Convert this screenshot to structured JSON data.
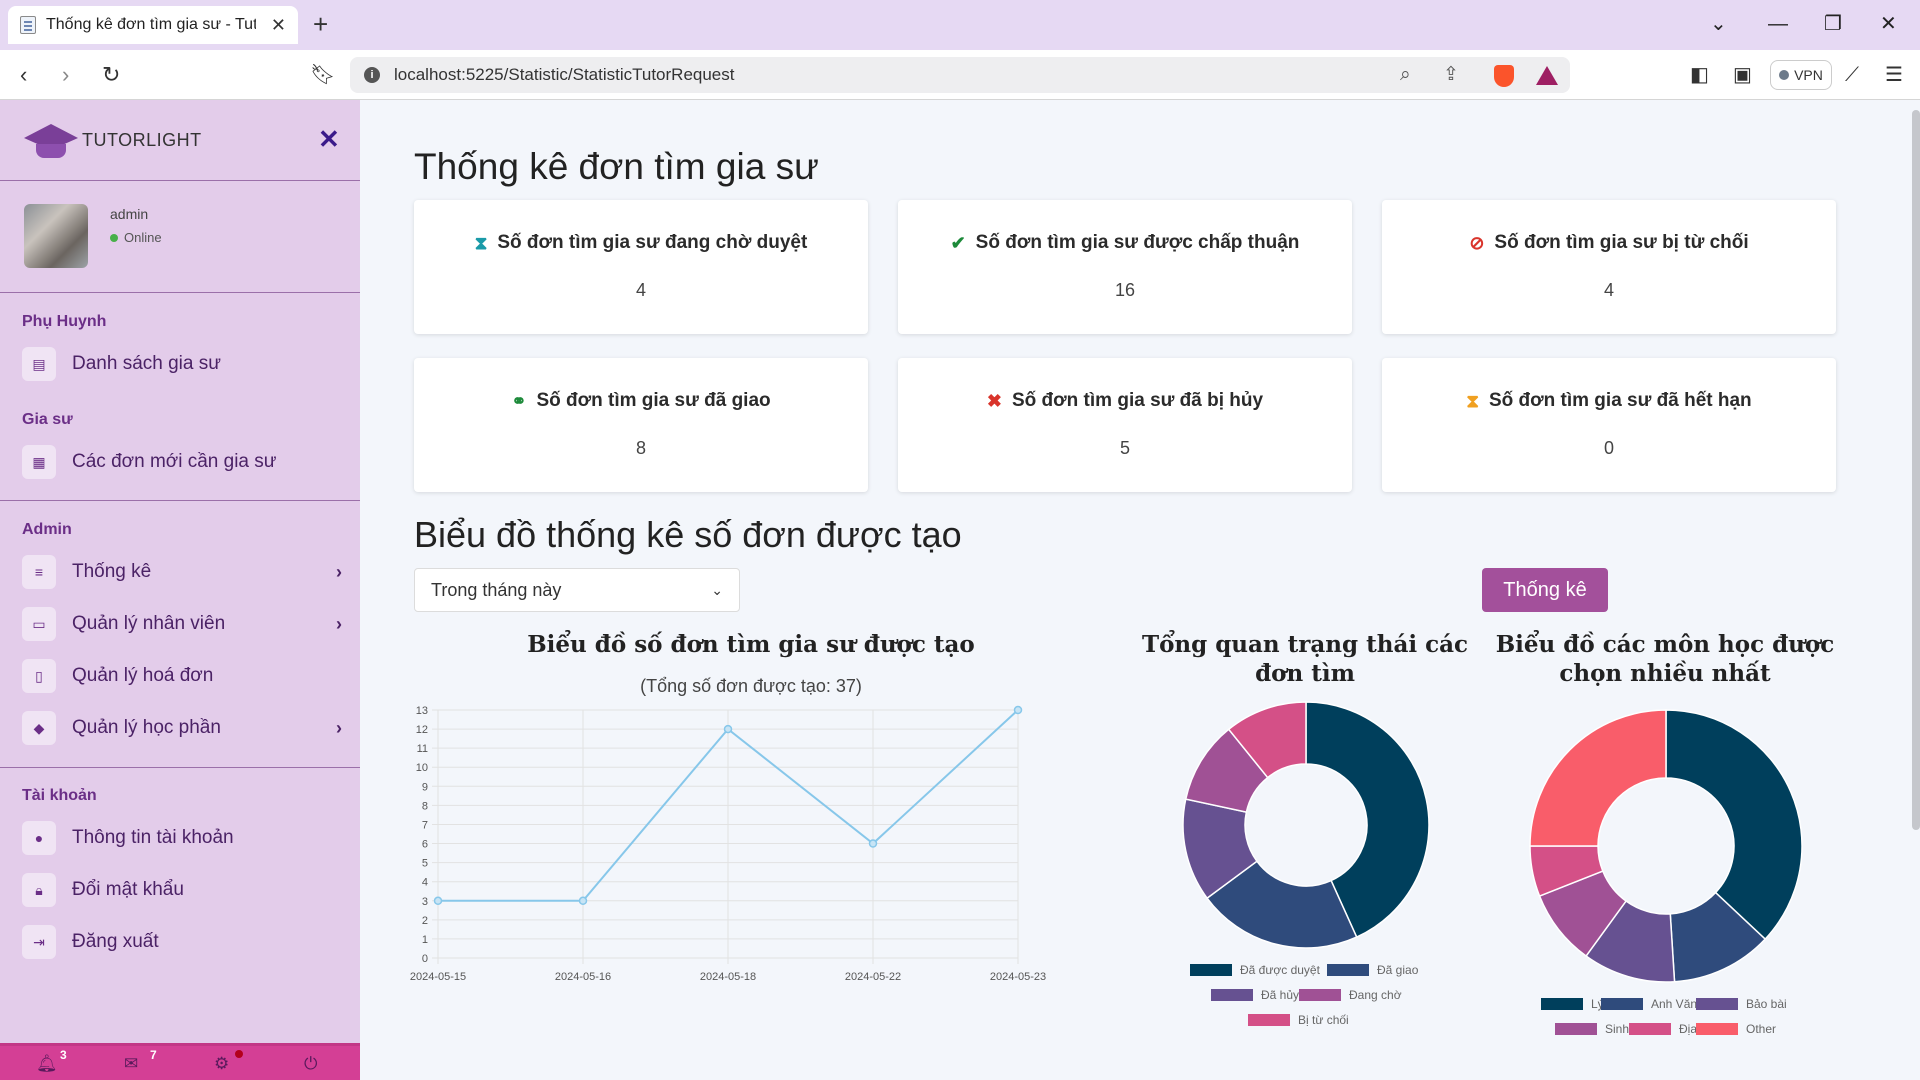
{
  "browser": {
    "tab_title": "Thống kê đơn tìm gia sư - Tutor",
    "url": "localhost:5225/Statistic/StatisticTutorRequest",
    "vpn_label": "VPN"
  },
  "sidebar": {
    "logo_text": "TUTORLIGHT",
    "user": {
      "name": "admin",
      "status": "Online"
    },
    "sections": [
      {
        "title": "Phụ Huynh",
        "items": [
          {
            "label": "Danh sách gia sư",
            "icon": "id-card-icon"
          }
        ]
      },
      {
        "title": "Gia sư",
        "items": [
          {
            "label": "Các đơn mới cần gia sư",
            "icon": "calendar-icon"
          }
        ]
      },
      {
        "title": "Admin",
        "items": [
          {
            "label": "Thống kê",
            "icon": "list-icon",
            "has_submenu": true
          },
          {
            "label": "Quản lý nhân viên",
            "icon": "laptop-icon",
            "has_submenu": true
          },
          {
            "label": "Quản lý hoá đơn",
            "icon": "invoice-icon"
          },
          {
            "label": "Quản lý học phần",
            "icon": "graduation-cap-icon",
            "has_submenu": true
          }
        ]
      },
      {
        "title": "Tài khoản",
        "items": [
          {
            "label": "Thông tin tài khoản",
            "icon": "info-icon"
          },
          {
            "label": "Đổi mật khẩu",
            "icon": "lock-icon"
          },
          {
            "label": "Đăng xuất",
            "icon": "logout-icon"
          }
        ]
      }
    ],
    "footer": {
      "notifications": "3",
      "messages": "7"
    }
  },
  "main": {
    "title": "Thống kê đơn tìm gia sư",
    "cards": [
      {
        "label": "Số đơn tìm gia sư đang chờ duyệt",
        "value": "4",
        "icon": "hourglass-icon",
        "icon_color": "#1a9aa8"
      },
      {
        "label": "Số đơn tìm gia sư được chấp thuận",
        "value": "16",
        "icon": "check-icon",
        "icon_color": "#1d8a3a"
      },
      {
        "label": "Số đơn tìm gia sư bị từ chối",
        "value": "4",
        "icon": "ban-icon",
        "icon_color": "#d9342b"
      },
      {
        "label": "Số đơn tìm gia sư đã giao",
        "value": "8",
        "icon": "handshake-icon",
        "icon_color": "#1d8a3a"
      },
      {
        "label": "Số đơn tìm gia sư đã bị hủy",
        "value": "5",
        "icon": "x-icon",
        "icon_color": "#d9342b"
      },
      {
        "label": "Số đơn tìm gia sư đã hết hạn",
        "value": "0",
        "icon": "hourglass-end-icon",
        "icon_color": "#f0a020"
      }
    ],
    "chart_section_title": "Biểu đồ thống kê số đơn được tạo",
    "period_select": "Trong tháng này",
    "stat_button": "Thống kê"
  },
  "chart_data": [
    {
      "type": "line",
      "title": "Biểu đồ số đơn tìm gia sư được tạo",
      "subtitle": "(Tổng số đơn được tạo: 37)",
      "x": [
        "2024-05-15",
        "2024-05-16",
        "2024-05-18",
        "2024-05-22",
        "2024-05-23"
      ],
      "series": [
        {
          "values": [
            3,
            3,
            12,
            6,
            13
          ],
          "color": "#87c7ea"
        }
      ],
      "ylim": [
        0,
        13
      ],
      "grid": true
    },
    {
      "type": "pie",
      "title": "Tổng quan trạng thái các đơn tìm",
      "labels": [
        "Đã được duyệt",
        "Đã giao",
        "Đã hủy",
        "Đang chờ",
        "Bị từ chối"
      ],
      "values": [
        16,
        8,
        5,
        4,
        4
      ],
      "colors": [
        "#003f5c",
        "#2f4b7c",
        "#665191",
        "#a05195",
        "#d45087"
      ],
      "legend": "bottom"
    },
    {
      "type": "pie",
      "title": "Biểu đồ các môn học được chọn nhiều nhất",
      "labels": [
        "Lý",
        "Anh Văn",
        "Bảo bài",
        "Sinh",
        "Địa",
        "Other"
      ],
      "values": [
        37,
        12,
        11,
        9,
        6,
        25
      ],
      "colors": [
        "#003f5c",
        "#2f4b7c",
        "#665191",
        "#a05195",
        "#d45087",
        "#f95d6a"
      ],
      "legend": "bottom"
    }
  ]
}
